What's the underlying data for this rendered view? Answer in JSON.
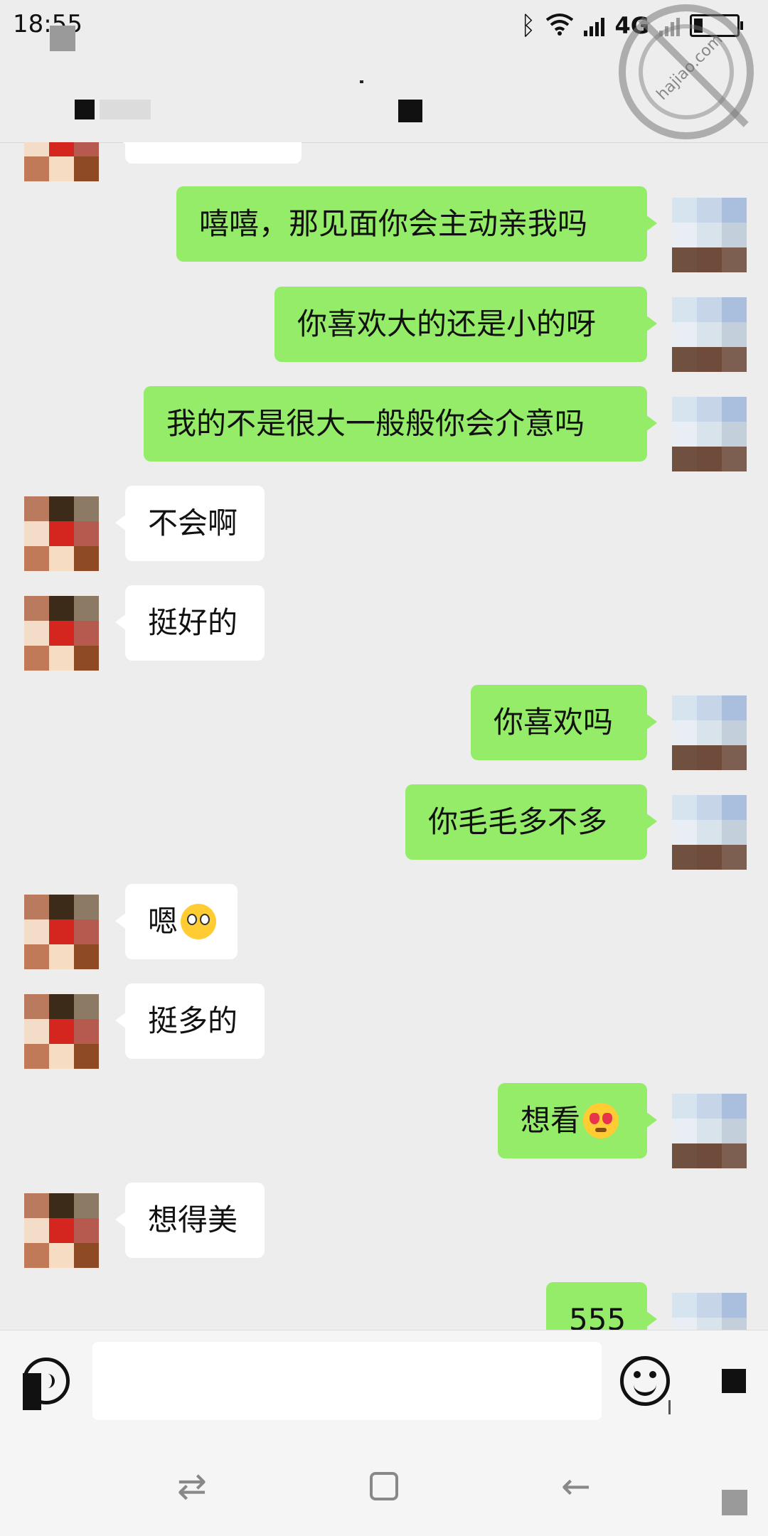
{
  "status_bar": {
    "time": "18:55",
    "network": "4G"
  },
  "watermark": {
    "text": "hajiao.com"
  },
  "messages": [
    {
      "side": "out",
      "text": "嘻嘻，那见面你会主动亲我吗"
    },
    {
      "side": "out",
      "text": "你喜欢大的还是小的呀"
    },
    {
      "side": "out",
      "text": "我的不是很大一般般你会介意吗"
    },
    {
      "side": "in",
      "text": "不会啊"
    },
    {
      "side": "in",
      "text": "挺好的"
    },
    {
      "side": "out",
      "text": "你喜欢吗"
    },
    {
      "side": "out",
      "text": "你毛毛多不多"
    },
    {
      "side": "in",
      "text": "嗯",
      "emoji": "flushed-face"
    },
    {
      "side": "in",
      "text": "挺多的"
    },
    {
      "side": "out",
      "text": "想看",
      "emoji": "heart-eyes-face"
    },
    {
      "side": "in",
      "text": "想得美"
    },
    {
      "side": "out",
      "text": "555"
    }
  ],
  "input": {
    "value": ""
  },
  "colors": {
    "outgoing_bubble": "#95ec69",
    "incoming_bubble": "#ffffff",
    "background": "#ededed"
  }
}
